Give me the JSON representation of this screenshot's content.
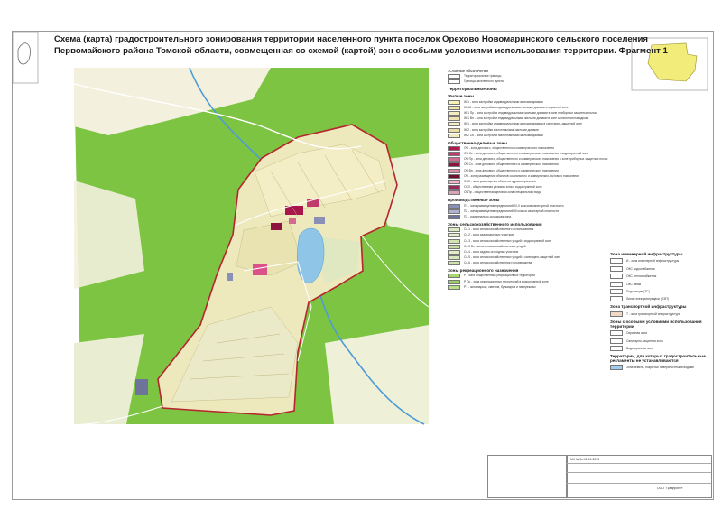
{
  "title": {
    "line1": "Схема (карта) градостроительного зонирования территории населенного пункта поселок Орехово Новомаринского сельского поселения",
    "line2": "Первомайского района Томской области, совмещенная со схемой (картой) зон с особыми условиями использования территории. Фрагмент 1"
  },
  "colors": {
    "forest": "#7cc442",
    "settlement_base": "#ede9bd",
    "boundary": "#b5262e",
    "water": "#8fc6e8",
    "residential": "#f4f0c8",
    "public": "#a8154a",
    "industrial": "#8a8fb8"
  },
  "legend": {
    "heading": "Условные обозначения",
    "boundaries": [
      {
        "label": "Территориальные границы"
      },
      {
        "label": "Граница населенного пункта"
      }
    ],
    "zones_title": "Территориальные зоны",
    "residential_title": "Жилые зоны",
    "residential": [
      {
        "color": "#f6f2b8",
        "label": "Ж-1 - зона застройки индивидуальными жилыми домами"
      },
      {
        "color": "#f0e6a8",
        "label": "Ж-1А - зона застройки индивидуальными жилыми домами в охранной зоне"
      },
      {
        "color": "#f3ecc0",
        "label": "Ж-1 Пр - зона застройки индивидуальными жилыми домами в зоне приборных защитных полос"
      },
      {
        "color": "#efe2b0",
        "label": "Ж-1 Вп - зона застройки индивидуальными жилыми домами в зоне затопления паводком"
      },
      {
        "color": "#f5efc8",
        "label": "Ж-1 - зона застройки индивидуальными жилыми домами в санитарно-защитной зоне"
      },
      {
        "color": "#ebdfa8",
        "label": "Ж-2 - зона застройки малоэтажными жилыми домами"
      },
      {
        "color": "#f1ebc4",
        "label": "Ж-2 Ос - зона застройки малоэтажными жилыми домами"
      }
    ],
    "public_title": "Общественно-деловые зоны",
    "public": [
      {
        "color": "#b21a4f",
        "label": "ОЧ - зона делового, общественного и коммерческого назначения"
      },
      {
        "color": "#c23a6b",
        "label": "ОЧ Ос - зона делового, общественного и коммерческого назначения в водоохранной зоне"
      },
      {
        "color": "#d36a8f",
        "label": "ОЧ Пр - зона делового, общественного и коммерческого назначения в зоне приборных защитных полос"
      },
      {
        "color": "#8c1240",
        "label": "ОЧ Сз - зона делового, общественного и коммерческого назначения"
      },
      {
        "color": "#e08aa8",
        "label": "ОЧ Вп - зона делового, общественного и коммерческого назначения"
      },
      {
        "color": "#6e0f33",
        "label": "ОЧ - зона размещения объектов социального и коммунально-бытового назначения"
      },
      {
        "color": "#f2b2c8",
        "label": "ОКО - зона размещения объектов здравоохранения"
      },
      {
        "color": "#9a2a5a",
        "label": "ОСЗ - общественная деловая зона в водоохранной зоне"
      },
      {
        "color": "#d9a3b9",
        "label": "ОКПр - общественная деловая зона специального вида"
      }
    ],
    "production_title": "Производственные зоны",
    "production": [
      {
        "color": "#8a8fb8",
        "label": "П1 - зона размещения предприятий IV-V классов санитарной опасности"
      },
      {
        "color": "#b0b3cf",
        "label": "П2 - зона размещения предприятий III класса санитарной опасности"
      },
      {
        "color": "#6e7399",
        "label": "П3 - коммунально-складская зона"
      }
    ],
    "agri_title": "Зоны сельскохозяйственного использования",
    "agri": [
      {
        "color": "#dcebc0",
        "label": "Сх-1 - зона сельскохозяйственного использования"
      },
      {
        "color": "#e6f0cc",
        "label": "Сх-2 - зона садоводческих участков"
      },
      {
        "color": "#d2e4b0",
        "label": "Сх-3 - зона сельскохозяйственных угодий в водоохранной зоне"
      },
      {
        "color": "#c8dca2",
        "label": "Сх-3 Вп - зона сельскохозяйственных угодий"
      },
      {
        "color": "#e1ecc6",
        "label": "Сх-4 - зона садово-огородных участков"
      },
      {
        "color": "#d8e8ba",
        "label": "Сх-5 - зона сельскохозяйственных угодий в санитарно-защитной зоне"
      },
      {
        "color": "#cfe3ad",
        "label": "Сх-6 - зона сельскохозяйственного производства"
      }
    ],
    "recreation_title": "Зоны рекреационного назначения",
    "recreation": [
      {
        "color": "#a7d86c",
        "label": "Р - зона общественных рекреационных территорий"
      },
      {
        "color": "#9bd062",
        "label": "Р Ос - зона рекреационных территорий в водоохранной зоне"
      },
      {
        "color": "#b8e084",
        "label": "Р1 - зона парков, скверов, бульваров и набережных"
      }
    ]
  },
  "legend_right": {
    "infra_title": "Зона инженерной инфраструктуры",
    "infra": [
      {
        "color": "#ffffff",
        "label": "И - зона инженерной инфраструктуры"
      },
      {
        "color": "#ffffff",
        "label": "ОКС водоснабжения"
      },
      {
        "color": "#ffffff",
        "label": "ОКС теплоснабжения"
      },
      {
        "color": "#ffffff",
        "label": "ОКС связи"
      },
      {
        "color": "#ffffff",
        "label": "Подстанция (ТС)"
      },
      {
        "color": "#ffffff",
        "label": "Линия электропередачи (ЛЭП)"
      }
    ],
    "transport_title": "Зона транспортной инфраструктуры",
    "transport": [
      {
        "color": "#f3d9c4",
        "label": "Т - зона транспортной инфраструктуры"
      }
    ],
    "special_title": "Зоны с особыми условиями использования территории",
    "special": [
      {
        "color": "#ffffff",
        "label": "Охранная зона"
      },
      {
        "color": "#ffffff",
        "label": "Санитарно-защитная зона"
      },
      {
        "color": "#ffffff",
        "label": "Водоохранная зона"
      }
    ],
    "territory_title": "Территории, для которых градостроительные регламенты не устанавливаются",
    "territory": [
      {
        "color": "#9ecdf0",
        "label": "Зона земель, покрытых поверхностными водами"
      }
    ]
  },
  "stamp": {
    "code": "МК № 5х-11-01-2013",
    "company": "ООО \"Градпроект\""
  }
}
